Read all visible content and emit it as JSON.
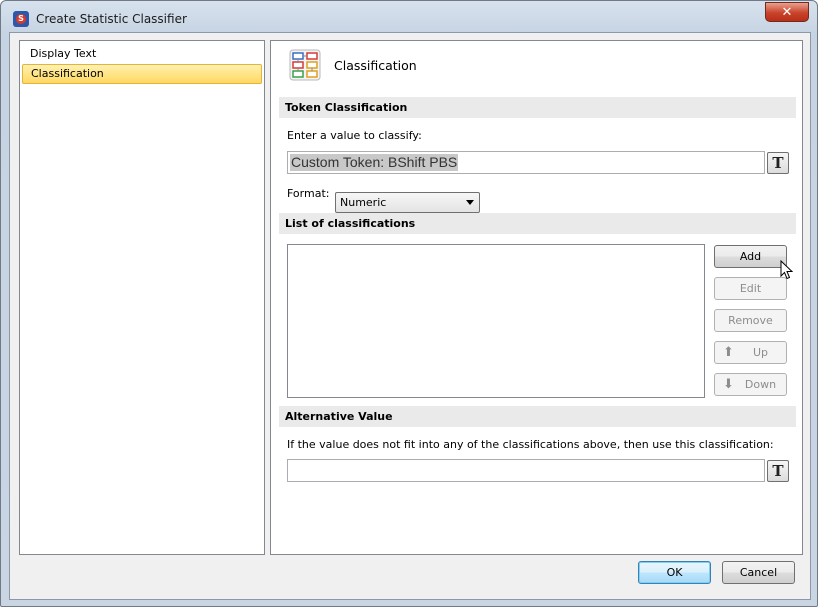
{
  "window": {
    "title": "Create Statistic Classifier",
    "close_glyph": "✕"
  },
  "nav": {
    "items": [
      {
        "label": "Display Text",
        "selected": false
      },
      {
        "label": "Classification",
        "selected": true
      }
    ]
  },
  "page": {
    "title": "Classification",
    "token_section": {
      "header": "Token Classification",
      "prompt": "Enter a value to classify:",
      "value": "Custom Token: BShift PBS",
      "token_button": "T",
      "format_label": "Format:",
      "format_value": "Numeric"
    },
    "list_section": {
      "header": "List of classifications",
      "items": [],
      "buttons": {
        "add": "Add",
        "edit": "Edit",
        "remove": "Remove",
        "up": "Up",
        "down": "Down"
      }
    },
    "alt_section": {
      "header": "Alternative Value",
      "prompt": "If the value does not fit into any of the classifications above, then use this classification:",
      "value": "",
      "token_button": "T"
    }
  },
  "footer": {
    "ok": "OK",
    "cancel": "Cancel"
  },
  "colors": {
    "selection": "#ffd861",
    "section_header_bg": "#eaeaea",
    "default_button_border": "#3c7fb1",
    "close_button": "#c9432b"
  },
  "icons": {
    "app": "app-logo-icon",
    "page": "classification-icon",
    "up": "up-arrow-icon",
    "down": "down-arrow-icon",
    "cursor": "mouse-pointer-icon"
  }
}
